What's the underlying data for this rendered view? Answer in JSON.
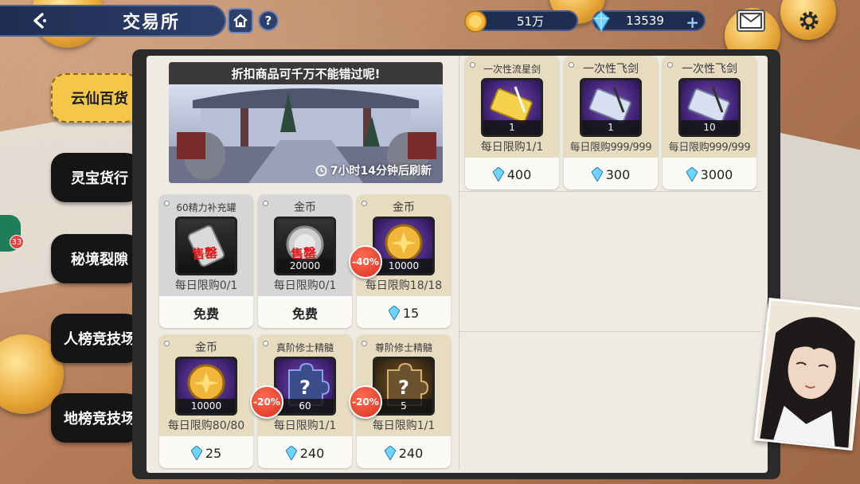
{
  "header": {
    "title": "交易所",
    "help_label": "?",
    "coins": "51万",
    "gems": "13539"
  },
  "tabs": [
    {
      "label": "云仙百货",
      "active": true
    },
    {
      "label": "灵宝货行",
      "active": false
    },
    {
      "label": "秘境裂隙",
      "active": false
    },
    {
      "label": "人榜竞技场",
      "active": false
    },
    {
      "label": "地榜竞技场",
      "active": false
    }
  ],
  "banner": {
    "headline": "折扣商品可千万不能错过呢!",
    "refresh": "7小时14分钟后刷新"
  },
  "notification_count": "33",
  "items": [
    {
      "name": "一次性流星剑",
      "qty": "1",
      "limit": "每日限购1/1",
      "price": "400",
      "currency": "gem",
      "theme": "gold",
      "icon": "ticket-icon"
    },
    {
      "name": "一次性飞剑",
      "qty": "1",
      "limit": "每日限购999/999",
      "price": "300",
      "currency": "gem",
      "theme": "gold",
      "icon": "ticket-icon"
    },
    {
      "name": "一次性飞剑",
      "qty": "10",
      "limit": "每日限购999/999",
      "price": "3000",
      "currency": "gem",
      "theme": "gold",
      "icon": "ticket-icon"
    },
    {
      "name": "60精力补充罐",
      "qty": "",
      "limit": "每日限购0/1",
      "price": "免费",
      "currency": "none",
      "theme": "gray",
      "icon": "can-icon",
      "sold": "售罄"
    },
    {
      "name": "金币",
      "qty": "20000",
      "limit": "每日限购0/1",
      "price": "免费",
      "currency": "none",
      "theme": "gray",
      "icon": "coin-icon",
      "sold": "售罄"
    },
    {
      "name": "金币",
      "qty": "10000",
      "limit": "每日限购18/18",
      "price": "15",
      "currency": "gem",
      "theme": "gold",
      "icon": "coin-icon",
      "discount": "-40%"
    },
    {
      "name": "金币",
      "qty": "10000",
      "limit": "每日限购80/80",
      "price": "25",
      "currency": "gem",
      "theme": "gold",
      "icon": "coin-icon"
    },
    {
      "name": "真阶修士精髓",
      "qty": "60",
      "limit": "每日限购1/1",
      "price": "240",
      "currency": "gem",
      "theme": "gold",
      "icon": "puzzle-icon",
      "discount": "-20%"
    },
    {
      "name": "尊阶修士精髓",
      "qty": "5",
      "limit": "每日限购1/1",
      "price": "240",
      "currency": "gem",
      "theme": "gold",
      "icon": "puzzle-icon",
      "discount": "-20%"
    }
  ]
}
